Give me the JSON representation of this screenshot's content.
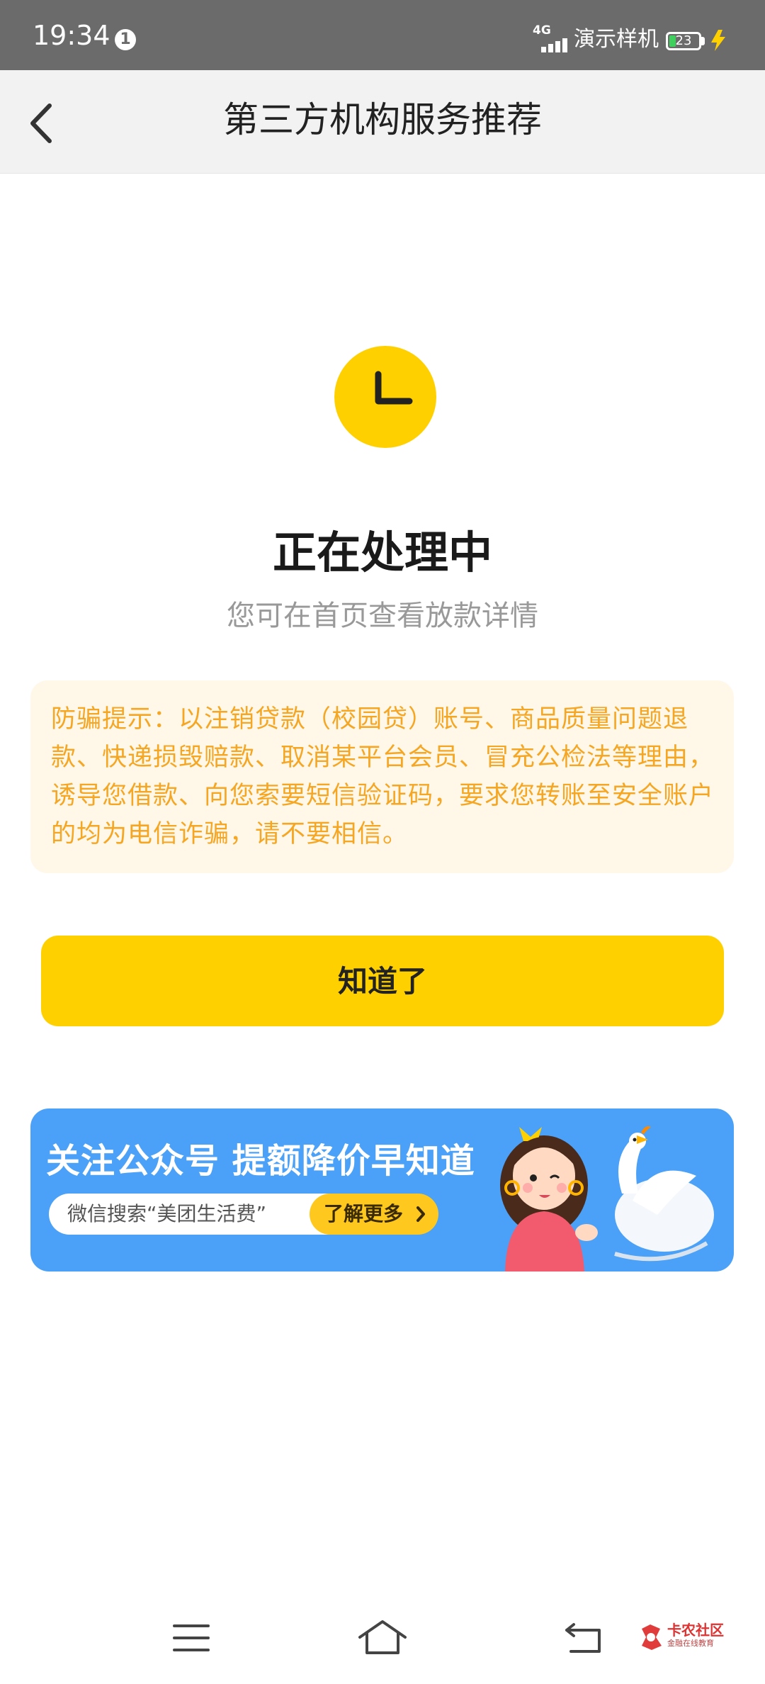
{
  "status_bar": {
    "time": "19:34",
    "notification_count": "1",
    "network": "4G",
    "carrier": "演示样机",
    "battery": "23"
  },
  "nav": {
    "title": "第三方机构服务推荐",
    "back_icon": "chevron-left-icon"
  },
  "status": {
    "icon": "clock-icon",
    "title": "正在处理中",
    "subtitle": "您可在首页查看放款详情"
  },
  "warning": {
    "text": "防骗提示：以注销贷款（校园贷）账号、商品质量问题退款、快递损毁赔款、取消某平台会员、冒充公检法等理由，诱导您借款、向您索要短信验证码，要求您转账至安全账户的均为电信诈骗，请不要相信。"
  },
  "confirm_button": {
    "label": "知道了"
  },
  "banner": {
    "headline": "关注公众号 提额降价早知道",
    "search_hint": "微信搜索“美团生活费”",
    "more_label": "了解更多"
  },
  "system_nav": {
    "menu_icon": "menu-icon",
    "home_icon": "home-icon",
    "back_icon": "back-icon"
  },
  "watermark": {
    "name": "卡农社区",
    "tagline": "金融在线教育"
  },
  "colors": {
    "accent": "#ffd000",
    "warning_text": "#f5a623",
    "warning_bg": "#fff7e8",
    "banner_bg": "#4ba1f7",
    "status_bar_bg": "#6b6b6b"
  }
}
